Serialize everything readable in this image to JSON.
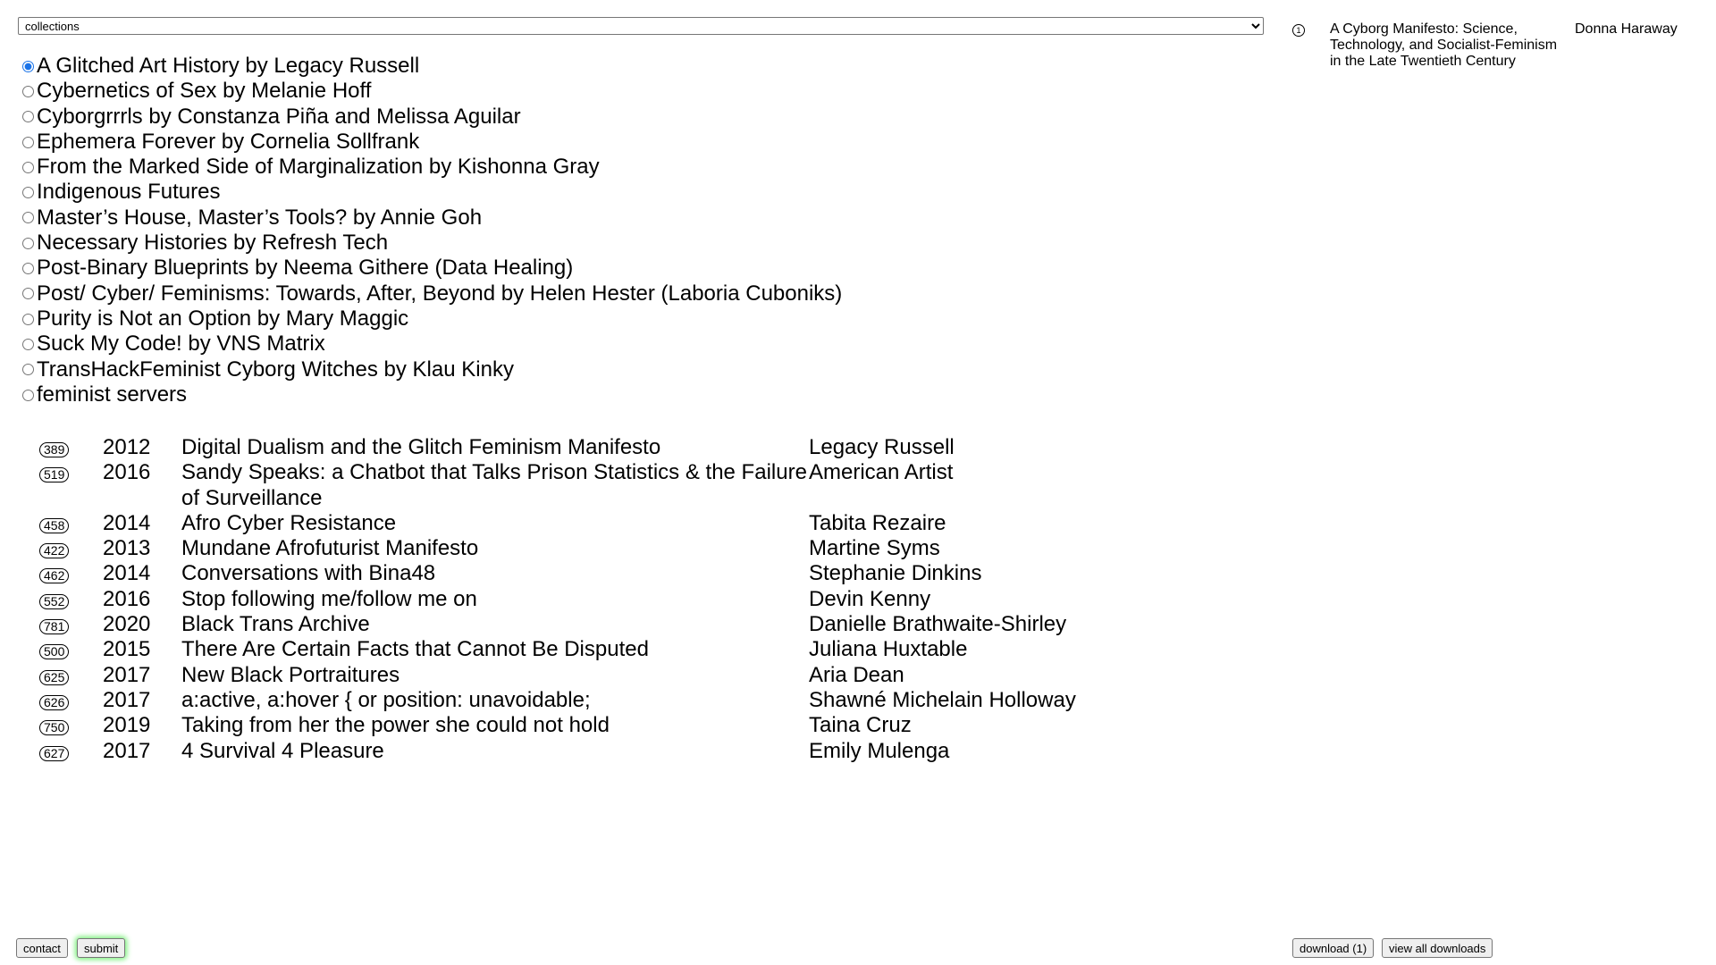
{
  "collections_select": {
    "selected": "collections"
  },
  "collections": [
    {
      "label": "A Glitched Art History by Legacy Russell",
      "checked": true
    },
    {
      "label": "Cybernetics of Sex by Melanie Hoff",
      "checked": false
    },
    {
      "label": "Cyborgrrrls by Constanza Piña and Melissa Aguilar",
      "checked": false
    },
    {
      "label": "Ephemera Forever by Cornelia Sollfrank",
      "checked": false
    },
    {
      "label": "From the Marked Side of Marginalization by Kishonna Gray",
      "checked": false
    },
    {
      "label": "Indigenous Futures",
      "checked": false
    },
    {
      "label": "Master’s House, Master’s Tools? by Annie Goh",
      "checked": false
    },
    {
      "label": "Necessary Histories by Refresh Tech",
      "checked": false
    },
    {
      "label": "Post-Binary Blueprints by Neema Githere (Data Healing)",
      "checked": false
    },
    {
      "label": "Post/ Cyber/ Feminisms: Towards, After, Beyond by Helen Hester (Laboria Cuboniks)",
      "checked": false
    },
    {
      "label": "Purity is Not an Option by Mary Maggic",
      "checked": false
    },
    {
      "label": "Suck My Code! by VNS Matrix",
      "checked": false
    },
    {
      "label": "TransHackFeminist Cyborg Witches by Klau Kinky",
      "checked": false
    },
    {
      "label": "feminist servers",
      "checked": false
    }
  ],
  "works": [
    {
      "id": "389",
      "year": "2012",
      "title": "Digital Dualism and the Glitch Feminism Manifesto",
      "artist": "Legacy Russell"
    },
    {
      "id": "519",
      "year": "2016",
      "title": "Sandy Speaks: a Chatbot that Talks Prison Statistics & the Failure of Surveillance",
      "artist": "American Artist"
    },
    {
      "id": "458",
      "year": "2014",
      "title": "Afro Cyber Resistance",
      "artist": "Tabita Rezaire"
    },
    {
      "id": "422",
      "year": "2013",
      "title": "Mundane Afrofuturist Manifesto",
      "artist": "Martine Syms"
    },
    {
      "id": "462",
      "year": "2014",
      "title": "Conversations with Bina48",
      "artist": "Stephanie Dinkins"
    },
    {
      "id": "552",
      "year": "2016",
      "title": "Stop following me/follow me on",
      "artist": "Devin Kenny"
    },
    {
      "id": "781",
      "year": "2020",
      "title": "Black Trans Archive",
      "artist": "Danielle Brathwaite-Shirley"
    },
    {
      "id": "500",
      "year": "2015",
      "title": "There Are Certain Facts that Cannot Be Disputed",
      "artist": "Juliana Huxtable"
    },
    {
      "id": "625",
      "year": "2017",
      "title": "New Black Portraitures",
      "artist": "Aria Dean"
    },
    {
      "id": "626",
      "year": "2017",
      "title": "a:active, a:hover { or position: unavoidable;",
      "artist": "Shawné Michelain Holloway"
    },
    {
      "id": "750",
      "year": "2019",
      "title": "Taking from her the power she could not hold",
      "artist": "Taina Cruz"
    },
    {
      "id": "627",
      "year": "2017",
      "title": "4 Survival 4 Pleasure",
      "artist": "Emily Mulenga"
    }
  ],
  "downloads": {
    "icon": "circle-count-icon",
    "icon_text": "1",
    "title": "A Cyborg Manifesto: Science, Technology, and Socialist-Feminism in the Late Twentieth Century",
    "author": "Donna Haraway"
  },
  "buttons": {
    "contact": "contact",
    "submit": "submit",
    "download": "download (1)",
    "view_all": "view all downloads"
  },
  "colors": {
    "submit_glow": "#7cf07c",
    "radio_accent": "#1a73e8"
  }
}
